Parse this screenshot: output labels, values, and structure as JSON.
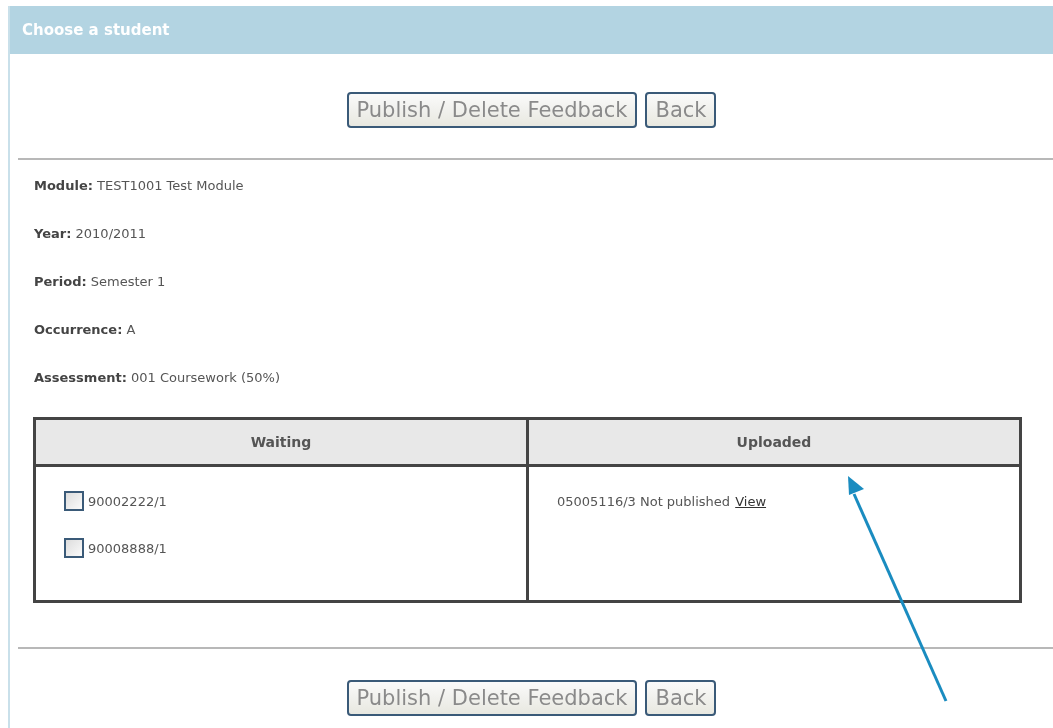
{
  "panel": {
    "title": "Choose a student"
  },
  "top_buttons": [
    "Publish / Delete Feedback",
    "Back"
  ],
  "details": [
    "**Module:** TEST1001 Test Module",
    "**Year:** 2010/2011",
    "**Period:** Semester 1",
    "**Occurrence:** A",
    "**Assessment:** 001 Coursework (50%)"
  ],
  "table": {
    "columns": [
      "Waiting",
      "Uploaded"
    ],
    "waiting": [
      {
        "label": "90002222/1",
        "checked": false
      },
      {
        "label": "90008888/1",
        "checked": false
      }
    ],
    "uploaded": [
      {
        "text": "05005116/3 Not published",
        "link": "View"
      }
    ]
  },
  "bottom_buttons": [
    "Publish / Delete Feedback",
    "Back"
  ]
}
